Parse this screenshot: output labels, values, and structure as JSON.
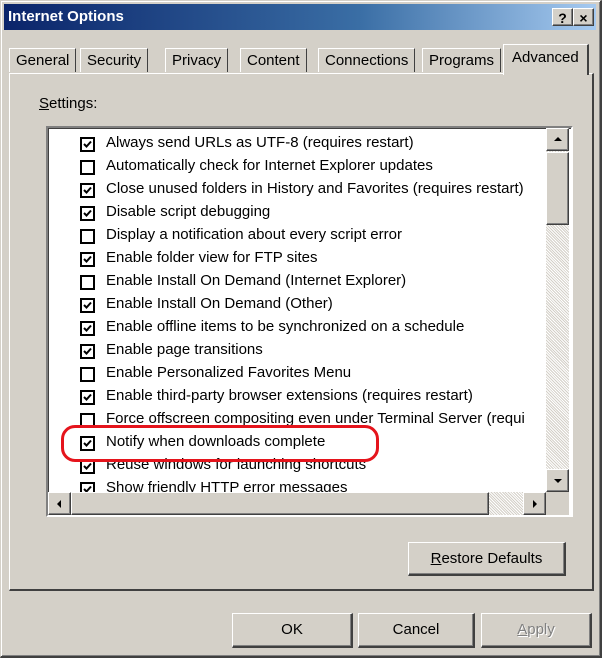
{
  "window": {
    "title": "Internet Options",
    "help_label": "?",
    "close_label": "×"
  },
  "tabs": [
    {
      "label": "General"
    },
    {
      "label": "Security"
    },
    {
      "label": "Privacy"
    },
    {
      "label": "Content"
    },
    {
      "label": "Connections"
    },
    {
      "label": "Programs"
    },
    {
      "label": "Advanced",
      "active": true
    }
  ],
  "settings": {
    "label_accel": "S",
    "label_rest": "ettings:",
    "items": [
      {
        "label": "Always send URLs as UTF-8 (requires restart)",
        "checked": true
      },
      {
        "label": "Automatically check for Internet Explorer updates",
        "checked": false
      },
      {
        "label": "Close unused folders in History and Favorites (requires restart)",
        "checked": true
      },
      {
        "label": "Disable script debugging",
        "checked": true
      },
      {
        "label": "Display a notification about every script error",
        "checked": false
      },
      {
        "label": "Enable folder view for FTP sites",
        "checked": true
      },
      {
        "label": "Enable Install On Demand (Internet Explorer)",
        "checked": false
      },
      {
        "label": "Enable Install On Demand (Other)",
        "checked": true
      },
      {
        "label": "Enable offline items to be synchronized on a schedule",
        "checked": true
      },
      {
        "label": "Enable page transitions",
        "checked": true
      },
      {
        "label": "Enable Personalized Favorites Menu",
        "checked": false
      },
      {
        "label": "Enable third-party browser extensions (requires restart)",
        "checked": true
      },
      {
        "label": "Force offscreen compositing even under Terminal Server (requi",
        "checked": false
      },
      {
        "label": "Notify when downloads complete",
        "checked": true
      },
      {
        "label": "Reuse windows for launching shortcuts",
        "checked": true
      },
      {
        "label": "Show friendly HTTP error messages",
        "checked": true
      }
    ]
  },
  "buttons": {
    "restore_accel": "R",
    "restore_rest": "estore Defaults",
    "ok": "OK",
    "cancel": "Cancel",
    "apply_accel": "A",
    "apply_rest": "pply"
  },
  "colors": {
    "highlight_outline": "#e5141c",
    "titlebar": "#0a246a"
  }
}
